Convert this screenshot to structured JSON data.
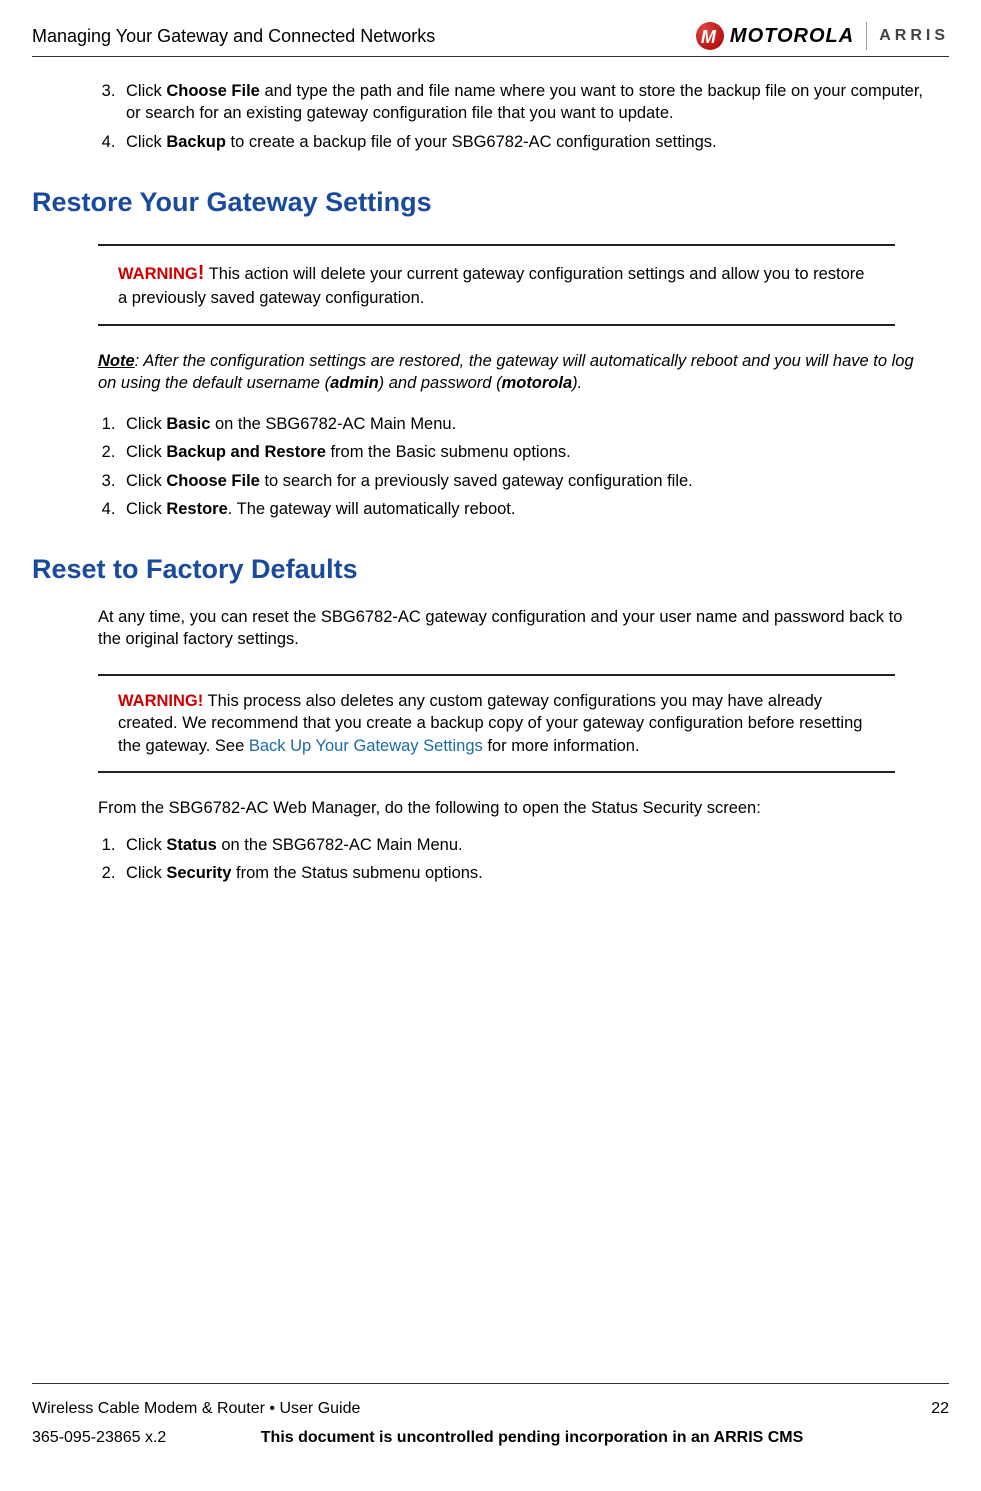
{
  "header": {
    "title": "Managing Your Gateway and Connected Networks",
    "logo_moto": "MOTOROLA",
    "logo_arris": "ARRIS"
  },
  "top_steps": [
    {
      "num": "3.",
      "pre": "Click ",
      "bold": "Choose File",
      "post": " and type the path and file name where you want to store the backup file on your computer, or search for an existing gateway configuration file that you want to update."
    },
    {
      "num": "4.",
      "pre": "Click ",
      "bold": "Backup",
      "post": " to create a backup file of your SBG6782-AC configuration settings."
    }
  ],
  "restore": {
    "heading": "Restore Your Gateway Settings",
    "warning_label": "WARNING",
    "warning_text": " This action will delete your current gateway configuration settings and allow you to restore a previously saved gateway configuration.",
    "note_lead": "Note",
    "note_text_1": ": After the configuration settings are restored, the gateway will automatically reboot and you will have to log on using the default username (",
    "note_bold_1": "admin",
    "note_text_2": ") and password (",
    "note_bold_2": "motorola",
    "note_text_3": ").",
    "steps": [
      {
        "pre": "Click ",
        "bold": "Basic",
        "post": " on the SBG6782-AC Main Menu."
      },
      {
        "pre": "Click ",
        "bold": "Backup and Restore",
        "post": " from the Basic submenu options."
      },
      {
        "pre": "Click ",
        "bold": "Choose File",
        "post": " to search for a previously saved gateway configuration file."
      },
      {
        "pre": "Click ",
        "bold": "Restore",
        "post": ". The gateway will automatically reboot."
      }
    ]
  },
  "reset": {
    "heading": "Reset to Factory Defaults",
    "intro": "At any time, you can reset the SBG6782-AC gateway configuration and your user name and password back to the original factory settings.",
    "warning_label": "WARNING!",
    "warning_text_1": " This process also deletes any custom gateway configurations you may have already created. We recommend that you create a backup copy of your gateway configuration before resetting the gateway. See ",
    "warning_link": "Back Up Your Gateway Settings",
    "warning_text_2": " for more information.",
    "lead_in": "From the SBG6782-AC Web Manager, do the following to open the Status Security screen:",
    "steps": [
      {
        "pre": "Click ",
        "bold": "Status",
        "post": " on the SBG6782-AC Main Menu."
      },
      {
        "pre": "Click ",
        "bold": "Security",
        "post": " from the Status submenu options."
      }
    ]
  },
  "footer": {
    "guide": "Wireless Cable Modem & Router • User Guide",
    "page_num": "22",
    "docnum": "365-095-23865 x.2",
    "notice": "This document is uncontrolled pending incorporation in an ARRIS CMS"
  }
}
